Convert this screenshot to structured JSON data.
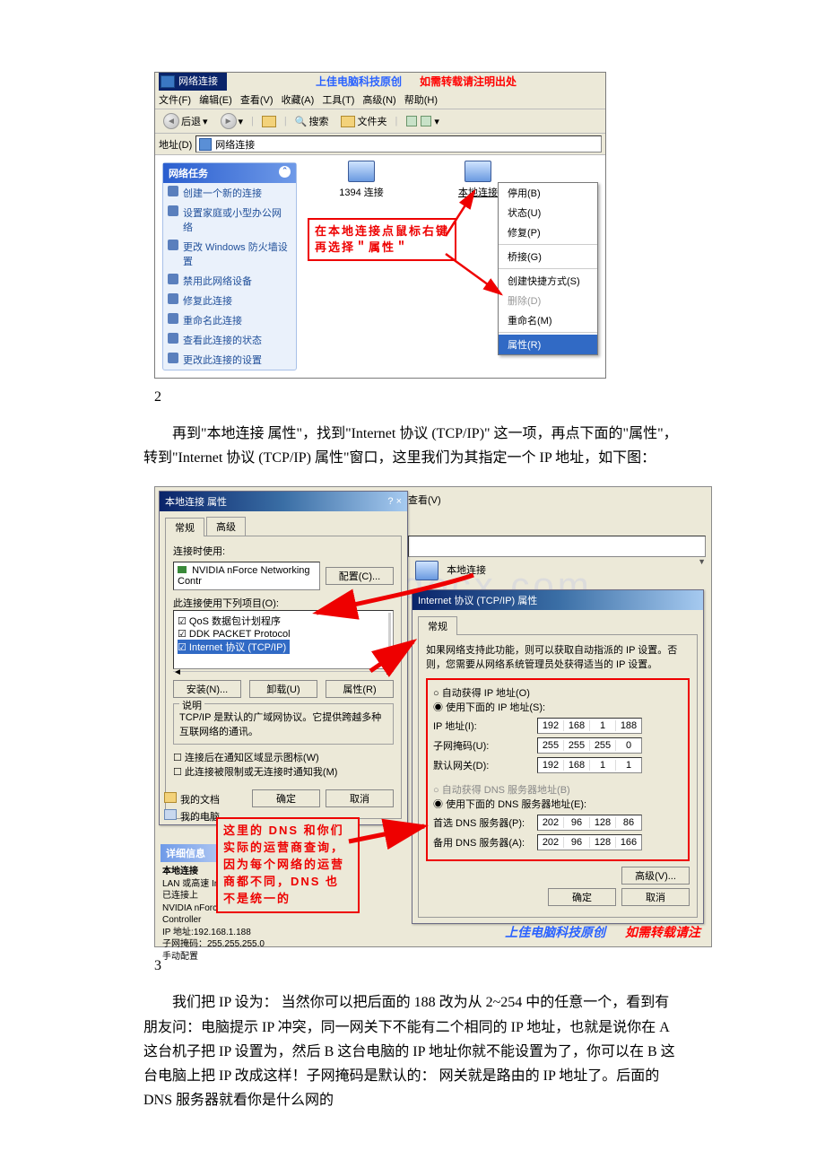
{
  "figure1": {
    "title": "网络连接",
    "brand_original": "上佳电脑科技原创",
    "brand_repost": "如需转载请注明出处",
    "menu": {
      "file": "文件(F)",
      "edit": "编辑(E)",
      "view": "查看(V)",
      "fav": "收藏(A)",
      "tools": "工具(T)",
      "adv": "高级(N)",
      "help": "帮助(H)"
    },
    "toolbar": {
      "back": "后退",
      "search": "搜索",
      "folders": "文件夹"
    },
    "address_label": "地址(D)",
    "address_value": "网络连接",
    "task_header": "网络任务",
    "tasks": [
      "创建一个新的连接",
      "设置家庭或小型办公网络",
      "更改 Windows 防火墙设置",
      "禁用此网络设备",
      "修复此连接",
      "重命名此连接",
      "查看此连接的状态",
      "更改此连接的设置"
    ],
    "conn_1394": "1394 连接",
    "conn_local": "本地连接",
    "context": {
      "disable": "停用(B)",
      "status": "状态(U)",
      "repair": "修复(P)",
      "bridge": "桥接(G)",
      "shortcut": "创建快捷方式(S)",
      "delete": "删除(D)",
      "rename": "重命名(M)",
      "properties": "属性(R)"
    },
    "callout": "在本地连接点鼠标右键再选择＂属性＂"
  },
  "step2_num": "2",
  "step2_text": "再到\"本地连接 属性\"，找到\"Internet 协议 (TCP/IP)\" 这一项，再点下面的\"属性\"，转到\"Internet 协议 (TCP/IP) 属性\"窗口，这里我们为其指定一个 IP 地址，如下图：",
  "figure2": {
    "watermark": "www.bdocx.com",
    "prop": {
      "title": "本地连接 属性",
      "tabs": {
        "general": "常规",
        "advanced": "高级"
      },
      "connect_using": "连接时使用:",
      "adapter": "NVIDIA nForce Networking Contr",
      "configure": "配置(C)...",
      "items_label": "此连接使用下列项目(O):",
      "items": [
        "QoS 数据包计划程序",
        "DDK PACKET Protocol",
        "Internet 协议 (TCP/IP)"
      ],
      "install": "安装(N)...",
      "uninstall": "卸载(U)",
      "properties": "属性(R)",
      "desc_label": "说明",
      "desc_text": "TCP/IP 是默认的广域网协议。它提供跨越多种互联网络的通讯。",
      "show_icon": "连接后在通知区域显示图标(W)",
      "notify_limited": "此连接被限制或无连接时通知我(M)",
      "ok": "确定",
      "cancel": "取消"
    },
    "explorer": {
      "menu_view": "查看(V)",
      "conn_local": "本地连接",
      "file_docs": "我的文档",
      "file_pc": "我的电脑",
      "details_header": "详细信息",
      "detail_name": "本地连接",
      "detail_type": "LAN 或高速 Internet",
      "detail_status": "已连接上",
      "detail_adapter": "NVIDIA nForce Networking Controller",
      "detail_ip": "IP 地址:192.168.1.188",
      "detail_mask": "子网掩码：255.255.255.0",
      "detail_manual": "手动配置"
    },
    "tcpip": {
      "title": "Internet 协议 (TCP/IP) 属性",
      "tab_general": "常规",
      "intro": "如果网络支持此功能，则可以获取自动指派的 IP 设置。否则，您需要从网络系统管理员处获得适当的 IP 设置。",
      "auto_ip": "自动获得 IP 地址(O)",
      "use_ip": "使用下面的 IP 地址(S):",
      "ip_label": "IP 地址(I):",
      "mask_label": "子网掩码(U):",
      "gw_label": "默认网关(D):",
      "auto_dns": "自动获得 DNS 服务器地址(B)",
      "use_dns": "使用下面的 DNS 服务器地址(E):",
      "dns1_label": "首选 DNS 服务器(P):",
      "dns2_label": "备用 DNS 服务器(A):",
      "adv_btn": "高级(V)...",
      "ok": "确定",
      "cancel": "取消",
      "ip": [
        "192",
        "168",
        "1",
        "188"
      ],
      "mask": [
        "255",
        "255",
        "255",
        "0"
      ],
      "gw": [
        "192",
        "168",
        "1",
        "1"
      ],
      "dns1": [
        "202",
        "96",
        "128",
        "86"
      ],
      "dns2": [
        "202",
        "96",
        "128",
        "166"
      ]
    },
    "callout_dns": "这里的 DNS 和你们实际的运营商查询，因为每个网络的运营商都不同，DNS 也不是统一的",
    "brand_original": "上佳电脑科技原创",
    "brand_repost": "如需转载请注"
  },
  "step3_num": "3",
  "step3_text": "我们把 IP 设为： 当然你可以把后面的 188 改为从 2~254 中的任意一个，看到有朋友问：电脑提示 IP 冲突，同一网关下不能有二个相同的 IP 地址，也就是说你在 A 这台机子把 IP 设置为，然后 B 这台电脑的 IP 地址你就不能设置为了，你可以在 B 这台电脑上把 IP 改成这样！子网掩码是默认的： 网关就是路由的 IP 地址了。后面的 DNS 服务器就看你是什么网的"
}
